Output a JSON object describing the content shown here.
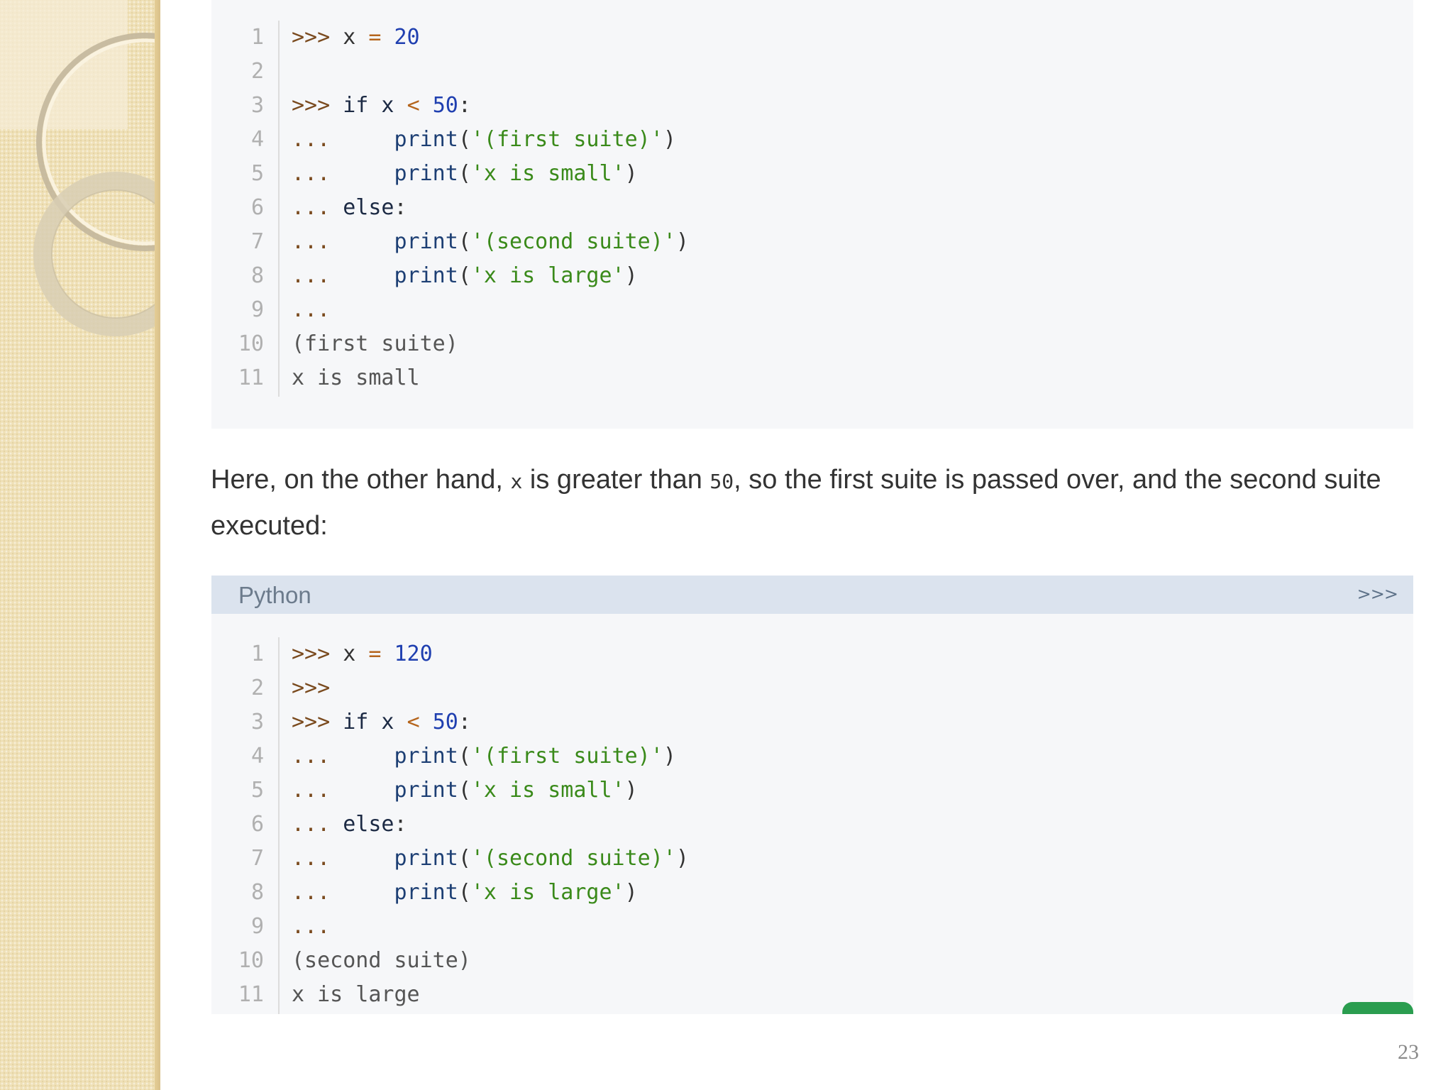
{
  "code_block_1": {
    "lines": [
      {
        "num": "1",
        "tokens": [
          {
            "t": ">>> ",
            "c": "t-prompt"
          },
          {
            "t": "x ",
            "c": "t-plain"
          },
          {
            "t": "=",
            "c": "t-op"
          },
          {
            "t": " ",
            "c": "t-plain"
          },
          {
            "t": "20",
            "c": "t-num"
          }
        ]
      },
      {
        "num": "2",
        "tokens": []
      },
      {
        "num": "3",
        "tokens": [
          {
            "t": ">>> ",
            "c": "t-prompt"
          },
          {
            "t": "if x ",
            "c": "t-kw"
          },
          {
            "t": "<",
            "c": "t-op"
          },
          {
            "t": " ",
            "c": "t-plain"
          },
          {
            "t": "50",
            "c": "t-num"
          },
          {
            "t": ":",
            "c": "t-plain"
          }
        ]
      },
      {
        "num": "4",
        "tokens": [
          {
            "t": "...     ",
            "c": "t-prompt"
          },
          {
            "t": "print",
            "c": "t-fn"
          },
          {
            "t": "(",
            "c": "t-plain"
          },
          {
            "t": "'(first suite)'",
            "c": "t-str"
          },
          {
            "t": ")",
            "c": "t-plain"
          }
        ]
      },
      {
        "num": "5",
        "tokens": [
          {
            "t": "...     ",
            "c": "t-prompt"
          },
          {
            "t": "print",
            "c": "t-fn"
          },
          {
            "t": "(",
            "c": "t-plain"
          },
          {
            "t": "'x is small'",
            "c": "t-str"
          },
          {
            "t": ")",
            "c": "t-plain"
          }
        ]
      },
      {
        "num": "6",
        "tokens": [
          {
            "t": "... ",
            "c": "t-prompt"
          },
          {
            "t": "else",
            "c": "t-kw"
          },
          {
            "t": ":",
            "c": "t-plain"
          }
        ]
      },
      {
        "num": "7",
        "tokens": [
          {
            "t": "...     ",
            "c": "t-prompt"
          },
          {
            "t": "print",
            "c": "t-fn"
          },
          {
            "t": "(",
            "c": "t-plain"
          },
          {
            "t": "'(second suite)'",
            "c": "t-str"
          },
          {
            "t": ")",
            "c": "t-plain"
          }
        ]
      },
      {
        "num": "8",
        "tokens": [
          {
            "t": "...     ",
            "c": "t-prompt"
          },
          {
            "t": "print",
            "c": "t-fn"
          },
          {
            "t": "(",
            "c": "t-plain"
          },
          {
            "t": "'x is large'",
            "c": "t-str"
          },
          {
            "t": ")",
            "c": "t-plain"
          }
        ]
      },
      {
        "num": "9",
        "tokens": [
          {
            "t": "...",
            "c": "t-prompt"
          }
        ]
      },
      {
        "num": "10",
        "tokens": [
          {
            "t": "(first suite)",
            "c": "t-out"
          }
        ]
      },
      {
        "num": "11",
        "tokens": [
          {
            "t": "x is small",
            "c": "t-out"
          }
        ]
      }
    ]
  },
  "paragraph": {
    "part1": "Here, on the other hand, ",
    "code1": "x",
    "part2": " is greater than ",
    "code2": "50",
    "part3": ", so the first suite is passed over, and the second suite executed:"
  },
  "code_block_2": {
    "language": "Python",
    "expand_label": ">>>",
    "lines": [
      {
        "num": "1",
        "tokens": [
          {
            "t": ">>> ",
            "c": "t-prompt"
          },
          {
            "t": "x ",
            "c": "t-plain"
          },
          {
            "t": "=",
            "c": "t-op"
          },
          {
            "t": " ",
            "c": "t-plain"
          },
          {
            "t": "120",
            "c": "t-num"
          }
        ]
      },
      {
        "num": "2",
        "tokens": [
          {
            "t": ">>>",
            "c": "t-prompt"
          }
        ]
      },
      {
        "num": "3",
        "tokens": [
          {
            "t": ">>> ",
            "c": "t-prompt"
          },
          {
            "t": "if x ",
            "c": "t-kw"
          },
          {
            "t": "<",
            "c": "t-op"
          },
          {
            "t": " ",
            "c": "t-plain"
          },
          {
            "t": "50",
            "c": "t-num"
          },
          {
            "t": ":",
            "c": "t-plain"
          }
        ]
      },
      {
        "num": "4",
        "tokens": [
          {
            "t": "...     ",
            "c": "t-prompt"
          },
          {
            "t": "print",
            "c": "t-fn"
          },
          {
            "t": "(",
            "c": "t-plain"
          },
          {
            "t": "'(first suite)'",
            "c": "t-str"
          },
          {
            "t": ")",
            "c": "t-plain"
          }
        ]
      },
      {
        "num": "5",
        "tokens": [
          {
            "t": "...     ",
            "c": "t-prompt"
          },
          {
            "t": "print",
            "c": "t-fn"
          },
          {
            "t": "(",
            "c": "t-plain"
          },
          {
            "t": "'x is small'",
            "c": "t-str"
          },
          {
            "t": ")",
            "c": "t-plain"
          }
        ]
      },
      {
        "num": "6",
        "tokens": [
          {
            "t": "... ",
            "c": "t-prompt"
          },
          {
            "t": "else",
            "c": "t-kw"
          },
          {
            "t": ":",
            "c": "t-plain"
          }
        ]
      },
      {
        "num": "7",
        "tokens": [
          {
            "t": "...     ",
            "c": "t-prompt"
          },
          {
            "t": "print",
            "c": "t-fn"
          },
          {
            "t": "(",
            "c": "t-plain"
          },
          {
            "t": "'(second suite)'",
            "c": "t-str"
          },
          {
            "t": ")",
            "c": "t-plain"
          }
        ]
      },
      {
        "num": "8",
        "tokens": [
          {
            "t": "...     ",
            "c": "t-prompt"
          },
          {
            "t": "print",
            "c": "t-fn"
          },
          {
            "t": "(",
            "c": "t-plain"
          },
          {
            "t": "'x is large'",
            "c": "t-str"
          },
          {
            "t": ")",
            "c": "t-plain"
          }
        ]
      },
      {
        "num": "9",
        "tokens": [
          {
            "t": "...",
            "c": "t-prompt"
          }
        ]
      },
      {
        "num": "10",
        "tokens": [
          {
            "t": "(second suite)",
            "c": "t-out"
          }
        ]
      },
      {
        "num": "11",
        "tokens": [
          {
            "t": "x is large",
            "c": "t-out"
          }
        ]
      }
    ]
  },
  "page_number": "23",
  "colors": {
    "panel": "#efe0b6",
    "code_background": "#f6f7f9",
    "code_header": "#dbe3ee",
    "string": "#3a8a1a",
    "number": "#1f3fb0",
    "prompt": "#7a4a1e",
    "accent_green": "#2a9d4f"
  }
}
